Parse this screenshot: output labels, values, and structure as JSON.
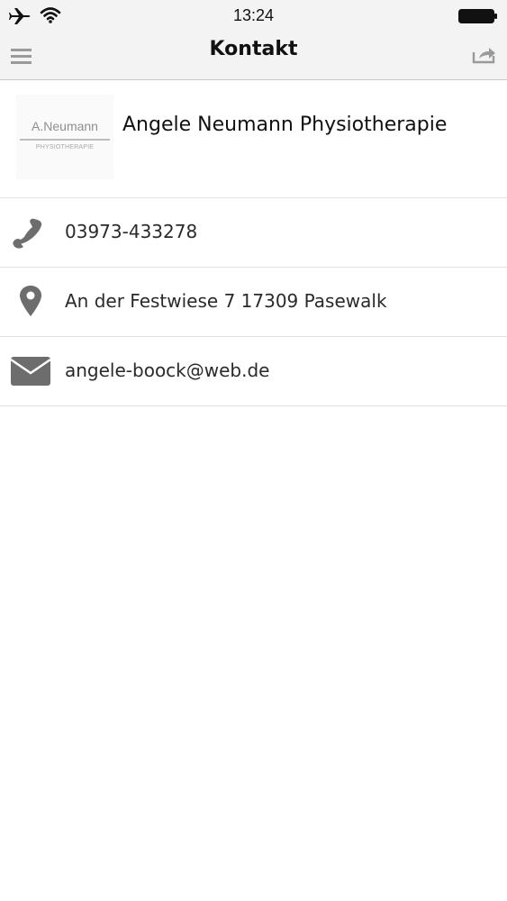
{
  "status_bar": {
    "time": "13:24",
    "icons": [
      "airplane-icon",
      "wifi-icon",
      "battery-icon"
    ]
  },
  "nav": {
    "title": "Kontakt",
    "left_icon": "hamburger-menu-icon",
    "right_icon": "share-icon"
  },
  "company": {
    "name": "Angele Neumann Physiotherapie",
    "logo": {
      "name": "A.Neumann",
      "subtitle": "PHYSIOTHERAPIE"
    }
  },
  "contacts": [
    {
      "type": "phone",
      "icon": "phone-icon",
      "value": "03973-433278"
    },
    {
      "type": "address",
      "icon": "map-pin-icon",
      "value": "An der Festwiese 7 17309 Pasewalk"
    },
    {
      "type": "email",
      "icon": "envelope-icon",
      "value": "angele-boock@web.de"
    }
  ],
  "colors": {
    "bar_background": "#f3f3f3",
    "icon_gray": "#6d6d6d",
    "divider": "#e2e2e2"
  }
}
